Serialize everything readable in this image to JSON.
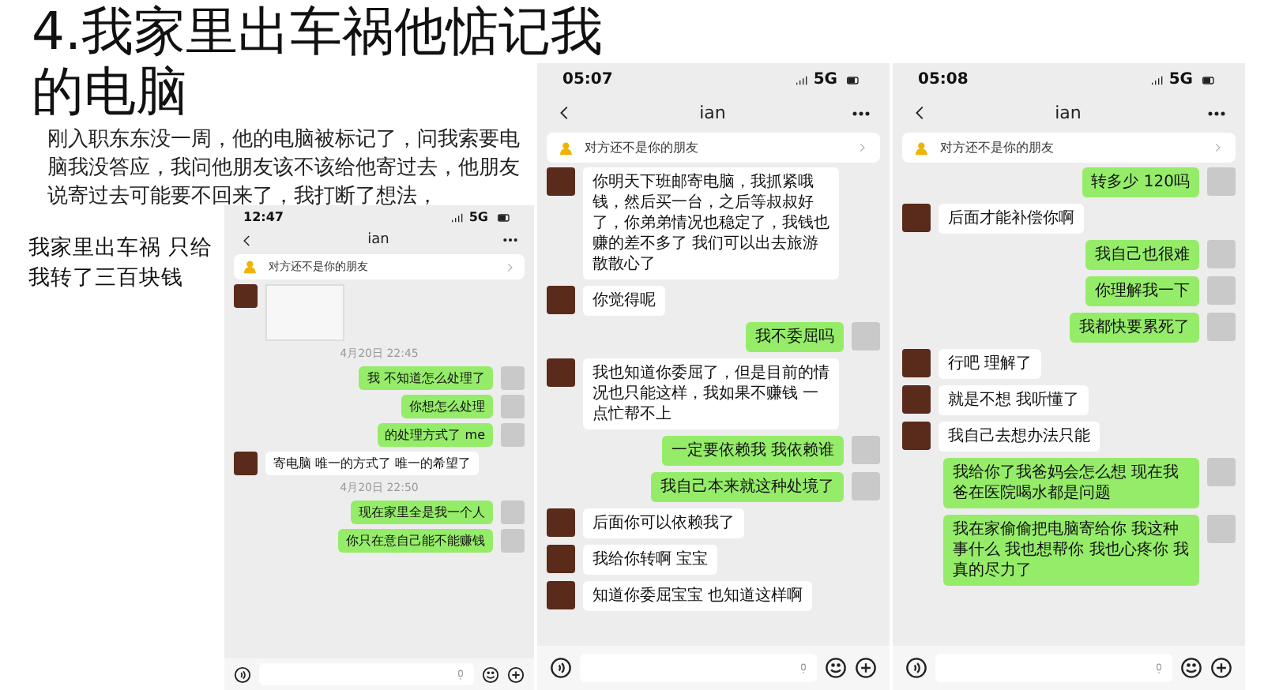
{
  "slide": {
    "title_lines": [
      "4.我家里出车祸他惦记我",
      "的电脑"
    ],
    "paragraph": "刚入职东东没一周，他的电脑被标记了，问我索要电脑我没答应，我问他朋友该不该给他寄过去，他朋友说寄过去可能要不回来了，我打断了想法，",
    "side_note": "我家里出车祸 只给我转了三百块钱"
  },
  "phones": [
    {
      "time": "12:47",
      "network": "5G",
      "contact": "ian",
      "banner": "对方还不是你的朋友",
      "messages": [
        {
          "kind": "image",
          "outgoing": false
        },
        {
          "kind": "time",
          "text": "4月20日 22:45"
        },
        {
          "kind": "text",
          "outgoing": true,
          "text": "我 不知道怎么处理了"
        },
        {
          "kind": "text",
          "outgoing": true,
          "text": "你想怎么处理"
        },
        {
          "kind": "text",
          "outgoing": true,
          "text": "的处理方式了 me"
        },
        {
          "kind": "text",
          "outgoing": false,
          "text": "寄电脑 唯一的方式了 唯一的希望了"
        },
        {
          "kind": "time",
          "text": "4月20日 22:50"
        },
        {
          "kind": "text",
          "outgoing": true,
          "text": "现在家里全是我一个人"
        },
        {
          "kind": "text",
          "outgoing": true,
          "text": "你只在意自己能不能赚钱"
        }
      ]
    },
    {
      "time": "05:07",
      "network": "5G",
      "contact": "ian",
      "banner": "对方还不是你的朋友",
      "messages": [
        {
          "kind": "text",
          "outgoing": false,
          "text": "你明天下班邮寄电脑，我抓紧哦钱，然后买一台，之后等叔叔好了，你弟弟情况也稳定了，我钱也赚的差不多了 我们可以出去旅游散散心了"
        },
        {
          "kind": "text",
          "outgoing": false,
          "text": "你觉得呢"
        },
        {
          "kind": "text",
          "outgoing": true,
          "text": "我不委屈吗"
        },
        {
          "kind": "text",
          "outgoing": false,
          "text": "我也知道你委屈了，但是目前的情况也只能这样，我如果不赚钱 一点忙帮不上"
        },
        {
          "kind": "text",
          "outgoing": true,
          "text": "一定要依赖我 我依赖谁"
        },
        {
          "kind": "text",
          "outgoing": true,
          "text": "我自己本来就这种处境了"
        },
        {
          "kind": "text",
          "outgoing": false,
          "text": "后面你可以依赖我了"
        },
        {
          "kind": "text",
          "outgoing": false,
          "text": "我给你转啊 宝宝"
        },
        {
          "kind": "text",
          "outgoing": false,
          "text": "知道你委屈宝宝 也知道这样啊"
        }
      ]
    },
    {
      "time": "05:08",
      "network": "5G",
      "contact": "ian",
      "banner": "对方还不是你的朋友",
      "messages": [
        {
          "kind": "text",
          "outgoing": true,
          "text": "转多少 120吗"
        },
        {
          "kind": "text",
          "outgoing": false,
          "text": "后面才能补偿你啊"
        },
        {
          "kind": "text",
          "outgoing": true,
          "text": "我自己也很难"
        },
        {
          "kind": "text",
          "outgoing": true,
          "text": "你理解我一下"
        },
        {
          "kind": "text",
          "outgoing": true,
          "text": "我都快要累死了"
        },
        {
          "kind": "text",
          "outgoing": false,
          "text": "行吧 理解了"
        },
        {
          "kind": "text",
          "outgoing": false,
          "text": "就是不想 我听懂了"
        },
        {
          "kind": "text",
          "outgoing": false,
          "text": "我自己去想办法只能"
        },
        {
          "kind": "text",
          "outgoing": true,
          "text": "我给你了我爸妈会怎么想 现在我爸在医院喝水都是问题"
        },
        {
          "kind": "text",
          "outgoing": true,
          "text": "我在家偷偷把电脑寄给你 我这种事什么 我也想帮你 我也心疼你 我真的尽力了"
        }
      ]
    }
  ]
}
